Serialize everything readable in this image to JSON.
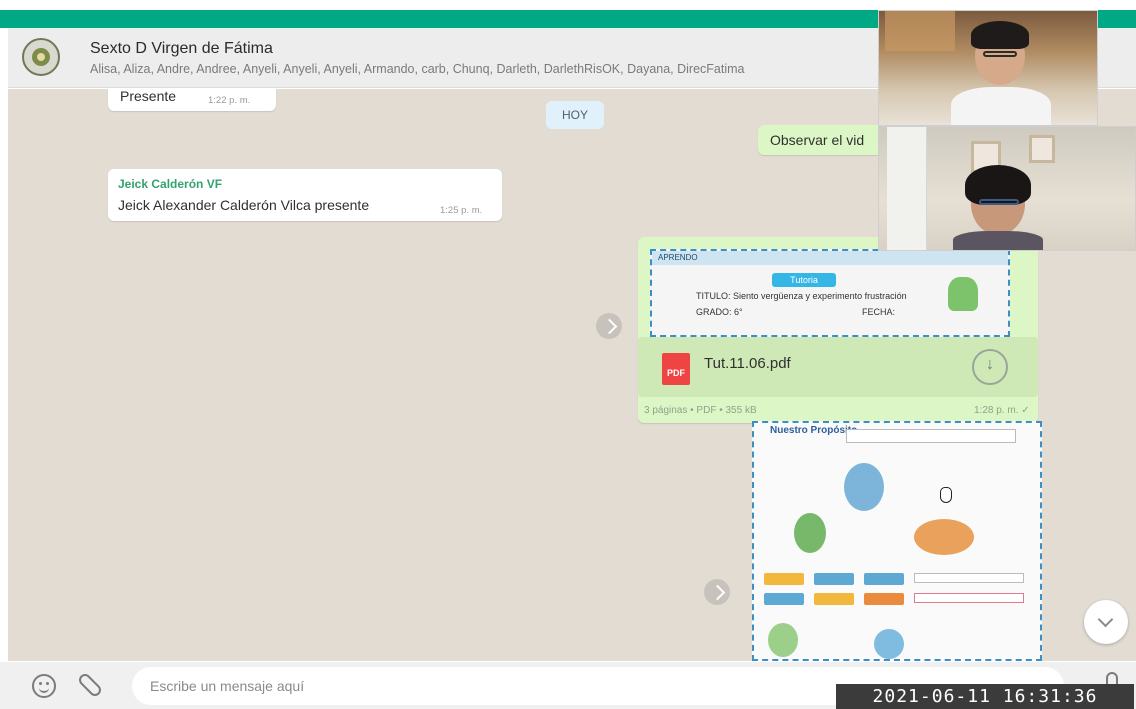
{
  "header": {
    "title": "Sexto D Virgen de Fátima",
    "members": "Alisa, Aliza, Andre, Andree, Anyeli, Anyeli, Anyeli, Armando, carb, Chunq, Darleth, DarlethRisOK, Dayana, DirecFatima"
  },
  "chat": {
    "date_chip": "HOY",
    "messages": [
      {
        "text": "Presente",
        "time": "1:22 p. m."
      },
      {
        "text": "Observar el vid"
      },
      {
        "sender": "Jeick Calderón VF",
        "text": "Jeick Alexander Calderón Vilca presente",
        "time": "1:25 p. m."
      }
    ],
    "document": {
      "preview_head": "APRENDO",
      "preview_chip": "Tutoria",
      "preview_title": "TITULO: Siento vergüenza y experimento frustración",
      "preview_grade": "GRADO: 6°",
      "preview_date": "FECHA:",
      "file_name": "Tut.11.06.pdf",
      "icon_label": "PDF",
      "meta": "3 páginas • PDF • 355 kB",
      "time": "1:28 p. m. ✓"
    },
    "page2": {
      "title": "Nuestro Propósito"
    }
  },
  "footer": {
    "placeholder": "Escribe un mensaje aquí"
  },
  "overlay_timestamp": "2021-06-11 16:31:36",
  "colors": {
    "accent": "#00a884",
    "chat_bg": "#e3dcd3",
    "outgoing_bubble": "#dcf6c6",
    "sender_name": "#35a26f"
  }
}
